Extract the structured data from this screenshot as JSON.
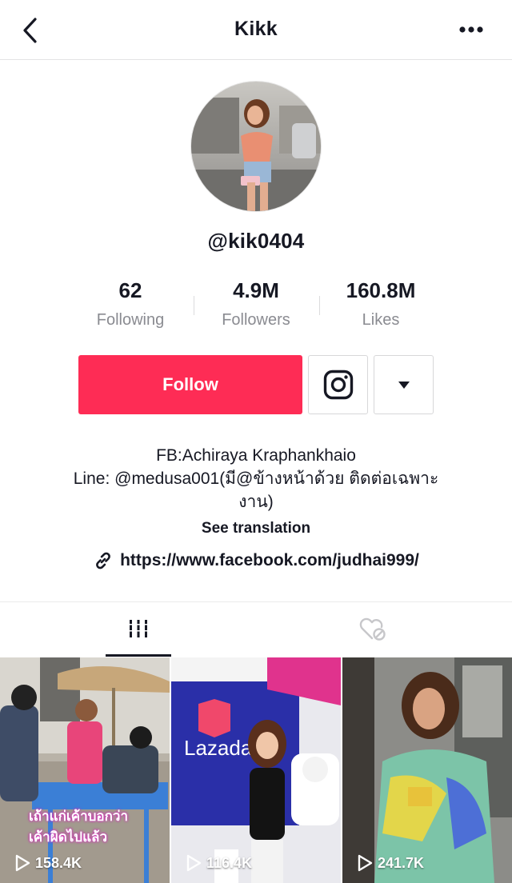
{
  "header": {
    "title": "Kikk"
  },
  "profile": {
    "username": "@kik0404",
    "stats": [
      {
        "value": "62",
        "label": "Following"
      },
      {
        "value": "4.9M",
        "label": "Followers"
      },
      {
        "value": "160.8M",
        "label": "Likes"
      }
    ],
    "follow_label": "Follow",
    "bio_lines": [
      "FB:Achiraya Kraphankhaio",
      "Line: @medusa001(มี@ข้างหน้าด้วย ติดต่อเฉพาะ",
      "งาน)"
    ],
    "see_translation": "See translation",
    "link": "https://www.facebook.com/judhai999/"
  },
  "colors": {
    "accent": "#fe2c55",
    "text": "#161823",
    "muted": "#8a8b91"
  },
  "tabs": {
    "videos_icon": "grid-icon",
    "liked_icon": "liked-hidden-icon"
  },
  "videos": [
    {
      "views": "158.4K",
      "caption_lines": [
        "เถ้าแก่เค้าบอกว่า",
        "เค้าผิดไปแล้ว"
      ]
    },
    {
      "views": "116.4K",
      "sign_text": "Lazada"
    },
    {
      "views": "241.7K"
    }
  ]
}
